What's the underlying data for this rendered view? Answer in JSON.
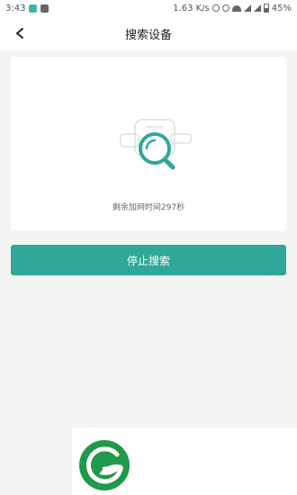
{
  "status_bar": {
    "time": "3:43",
    "speed": "1.63 K/s",
    "battery": "45%"
  },
  "header": {
    "title": "搜索设备"
  },
  "search": {
    "hint": "剩余加网时间297秒"
  },
  "actions": {
    "stop_label": "停止搜索"
  },
  "colors": {
    "accent": "#2fa89b",
    "background": "#f2f5f4",
    "logo_green": "#1e9a4a"
  },
  "icons": [
    "back-arrow-icon",
    "magnifier-icon",
    "lock-device-icon",
    "brand-logo-icon"
  ]
}
